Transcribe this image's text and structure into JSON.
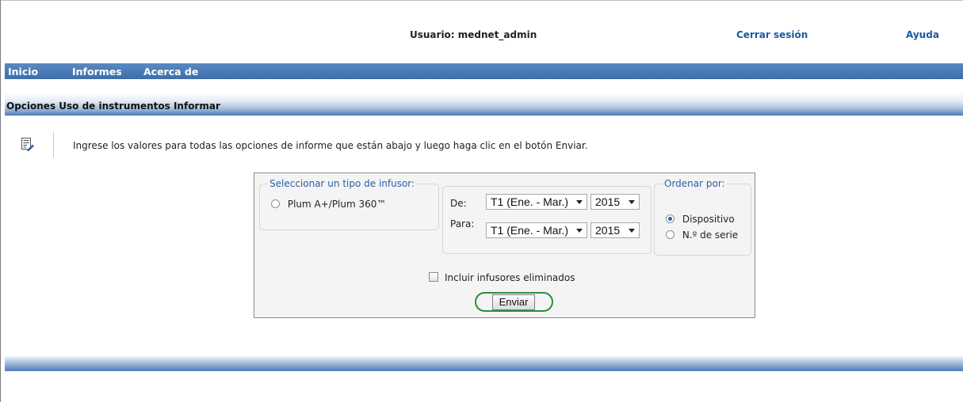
{
  "header": {
    "user_label": "Usuario: mednet_admin",
    "logout": "Cerrar sesión",
    "help": "Ayuda"
  },
  "nav": {
    "items": [
      "Inicio",
      "Informes",
      "Acerca de"
    ]
  },
  "section": {
    "title": "Opciones Uso de instrumentos Informar"
  },
  "instruction": {
    "icon": "form-edit-icon",
    "text": "Ingrese los valores para todas las opciones de informe que están abajo y luego haga clic en el botón Enviar."
  },
  "infuser_type": {
    "legend": "Seleccionar un tipo de infusor:",
    "options": [
      {
        "label": "Plum A+/Plum 360™",
        "selected": false
      }
    ]
  },
  "date_range": {
    "from_label": "De:",
    "to_label": "Para:",
    "from_quarter": "T1 (Ene. - Mar.)",
    "from_year": "2015",
    "to_quarter": "T1 (Ene. - Mar.)",
    "to_year": "2015"
  },
  "sort_by": {
    "legend": "Ordenar por:",
    "options": [
      {
        "label": "Dispositivo",
        "selected": true
      },
      {
        "label": "N.º de serie",
        "selected": false
      }
    ]
  },
  "include_deleted": {
    "label": "Incluir infusores eliminados",
    "checked": false
  },
  "submit": {
    "label": "Enviar"
  },
  "colors": {
    "nav_bar": "#4a7ab5",
    "link": "#1a5a9c",
    "legend": "#2a60a8",
    "highlight_ring": "#2e8f3a"
  }
}
